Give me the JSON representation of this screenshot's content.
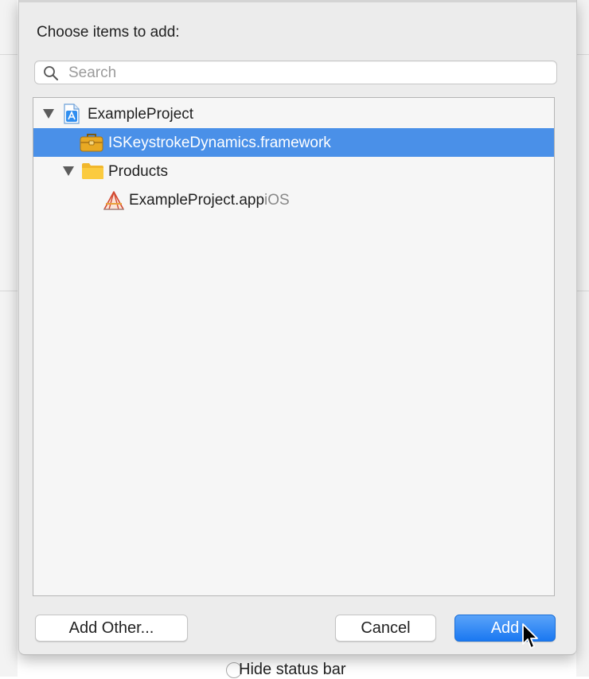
{
  "dialog": {
    "title": "Choose items to add:",
    "search": {
      "placeholder": "Search",
      "value": ""
    },
    "tree": [
      {
        "label": "ExampleProject",
        "suffix": "",
        "icon": "xcode-project-icon",
        "expanded": true,
        "selected": false
      },
      {
        "label": "ISKeystrokeDynamics.framework",
        "suffix": "",
        "icon": "framework-toolbox-icon",
        "selected": true
      },
      {
        "label": "Products",
        "suffix": "",
        "icon": "folder-icon",
        "expanded": true,
        "selected": false
      },
      {
        "label": "ExampleProject.app",
        "suffix": "iOS",
        "icon": "app-target-icon",
        "selected": false
      }
    ],
    "buttons": {
      "add_other": "Add Other...",
      "cancel": "Cancel",
      "add": "Add"
    }
  },
  "colors": {
    "selection": "#4a90e8",
    "primary_button": "#1a78f1",
    "sheet_background": "#ececec"
  },
  "background": {
    "partial_text": "Hide status bar"
  }
}
